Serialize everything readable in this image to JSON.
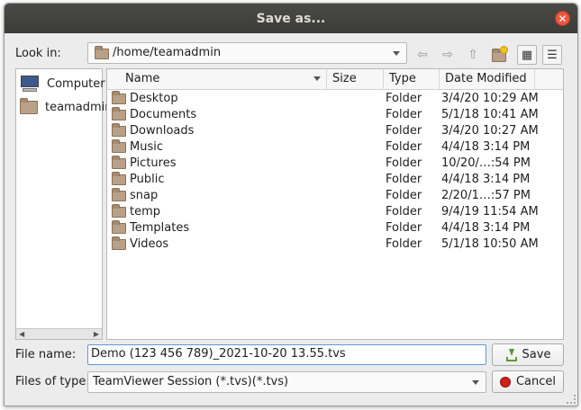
{
  "window": {
    "title": "Save as..."
  },
  "look_in": {
    "label": "Look in:",
    "path": "/home/teamadmin"
  },
  "toolbar": {
    "back_icon": "back-arrow-icon",
    "forward_icon": "forward-arrow-icon",
    "up_icon": "up-folder-icon",
    "new_folder_icon": "new-folder-icon",
    "list_view_icon": "list-view-icon",
    "detail_view_icon": "detail-view-icon"
  },
  "sidebar": {
    "items": [
      {
        "label": "Computer",
        "icon": "computer-icon"
      },
      {
        "label": "teamadmin",
        "icon": "folder-icon"
      }
    ]
  },
  "file_list": {
    "columns": [
      "Name",
      "Size",
      "Type",
      "Date Modified"
    ],
    "rows": [
      {
        "name": "Desktop",
        "size": "",
        "type": "Folder",
        "date": "3/4/20 10:29 AM"
      },
      {
        "name": "Documents",
        "size": "",
        "type": "Folder",
        "date": "5/1/18 10:41 AM"
      },
      {
        "name": "Downloads",
        "size": "",
        "type": "Folder",
        "date": "3/4/20 10:27 AM"
      },
      {
        "name": "Music",
        "size": "",
        "type": "Folder",
        "date": "4/4/18 3:14 PM"
      },
      {
        "name": "Pictures",
        "size": "",
        "type": "Folder",
        "date": "10/20/…:54 PM"
      },
      {
        "name": "Public",
        "size": "",
        "type": "Folder",
        "date": "4/4/18 3:14 PM"
      },
      {
        "name": "snap",
        "size": "",
        "type": "Folder",
        "date": "2/20/1…:57 PM"
      },
      {
        "name": "temp",
        "size": "",
        "type": "Folder",
        "date": "9/4/19 11:54 AM"
      },
      {
        "name": "Templates",
        "size": "",
        "type": "Folder",
        "date": "4/4/18 3:14 PM"
      },
      {
        "name": "Videos",
        "size": "",
        "type": "Folder",
        "date": "5/1/18 10:50 AM"
      }
    ]
  },
  "file_name": {
    "label": "File name:",
    "value": "Demo (123 456 789)_2021-10-20 13.55.tvs"
  },
  "file_type": {
    "label": "Files of type:",
    "value": "TeamViewer Session (*.tvs)(*.tvs)"
  },
  "buttons": {
    "save": "Save",
    "cancel": "Cancel"
  },
  "colors": {
    "titlebar": "#3d3d3a",
    "close": "#e9573f",
    "accent": "#5b9bd5"
  }
}
